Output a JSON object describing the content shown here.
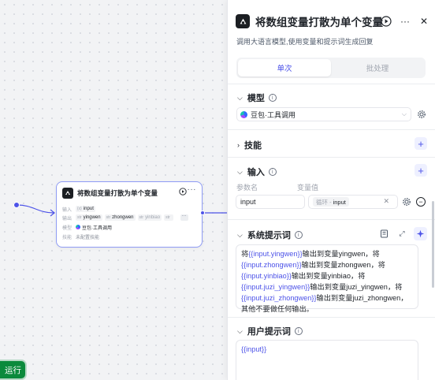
{
  "canvas": {
    "run_button_label": "运行"
  },
  "node": {
    "title": "将数组变量打散为单个变量",
    "input_label": "输入",
    "input_tag_type": "{x}",
    "input_tag_name": "input",
    "output_label": "输出",
    "outputs": [
      {
        "type": "str",
        "name": "yingwen"
      },
      {
        "type": "str",
        "name": "zhongwen"
      },
      {
        "type": "str",
        "name": "yinbiao"
      },
      {
        "type": "str",
        "name": "..."
      }
    ],
    "more_label": "···",
    "model_label": "模型",
    "model_name": "豆包·工具调用",
    "skill_label": "技能",
    "skill_value": "未配置技能"
  },
  "panel": {
    "title": "将数组变量打散为单个变量",
    "description": "调用大语言模型,使用变量和提示词生成回复",
    "tabs": [
      "单次",
      "批处理"
    ],
    "active_tab": "单次",
    "model_section": {
      "title": "模型",
      "selected_model": "豆包·工具调用"
    },
    "skill_section": {
      "title": "技能"
    },
    "input_section": {
      "title": "输入",
      "param_name_header": "参数名",
      "var_value_header": "变量值",
      "param_name": "input",
      "ref_source": "循环 -",
      "ref_var": "input"
    },
    "system_prompt": {
      "title": "系统提示词",
      "segments": [
        {
          "t": "将",
          "v": false
        },
        {
          "t": "{{input.yingwen}}",
          "v": true
        },
        {
          "t": "输出到变量yingwen，将",
          "v": false
        },
        {
          "t": "{{input.zhongwen}}",
          "v": true
        },
        {
          "t": "输出到变量zhongwen，将",
          "v": false
        },
        {
          "t": "{{input.yinbiao}}",
          "v": true
        },
        {
          "t": "输出到变量yinbiao，将",
          "v": false
        },
        {
          "t": "{{input.juzi_yingwen}}",
          "v": true
        },
        {
          "t": "输出到变量juzi_yingwen，将",
          "v": false
        },
        {
          "t": "{{input.juzi_zhongwen}}",
          "v": true
        },
        {
          "t": "输出到变量juzi_zhongwen，其他不要做任何输出。",
          "v": false
        }
      ]
    },
    "user_prompt": {
      "title": "用户提示词",
      "content": "{{input}}"
    }
  },
  "colors": {
    "accent": "#4d53e8",
    "run_green": "#0b8a3c",
    "node_border": "#8f9cf5"
  }
}
